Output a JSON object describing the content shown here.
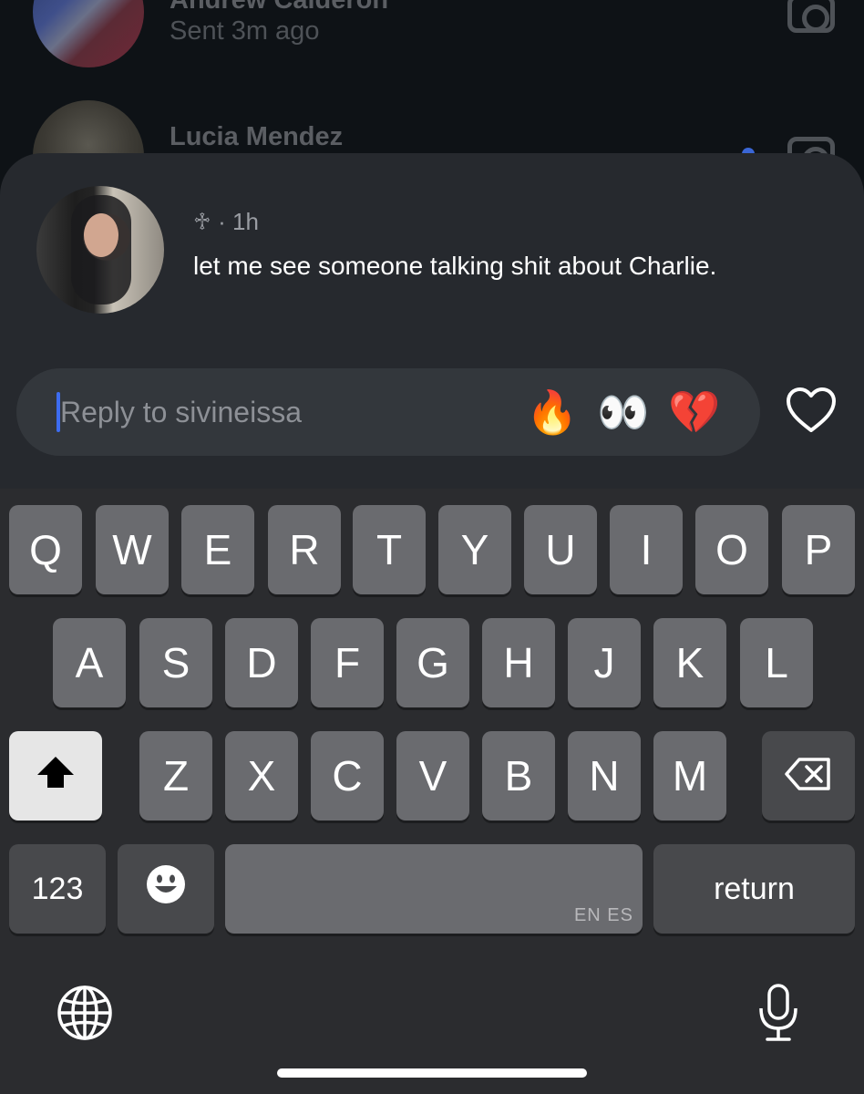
{
  "background_list": {
    "row1": {
      "name": "Andrew Calderon",
      "status": "Sent 3m ago"
    },
    "row2": {
      "name": "Lucia Mendez"
    }
  },
  "note": {
    "meta": "♱ · 1h",
    "text": "let me see someone talking shit about Charlie."
  },
  "reply": {
    "placeholder": "Reply to sivineissa",
    "quick_reactions": [
      "🔥",
      "👀",
      "💔"
    ]
  },
  "keyboard": {
    "row1": [
      "Q",
      "W",
      "E",
      "R",
      "T",
      "Y",
      "U",
      "I",
      "O",
      "P"
    ],
    "row2": [
      "A",
      "S",
      "D",
      "F",
      "G",
      "H",
      "J",
      "K",
      "L"
    ],
    "row3": [
      "Z",
      "X",
      "C",
      "V",
      "B",
      "N",
      "M"
    ],
    "numbers_label": "123",
    "return_label": "return",
    "space_language_tag": "EN ES"
  },
  "icons": {
    "heart": "heart-icon",
    "shift": "shift-icon",
    "backspace": "backspace-icon",
    "emoji": "emoji-icon",
    "globe": "globe-icon",
    "mic": "microphone-icon",
    "camera": "camera-icon"
  },
  "colors": {
    "caret": "#3d6cf0",
    "sheet": "#26292e",
    "keyboard": "#2b2c2f"
  }
}
